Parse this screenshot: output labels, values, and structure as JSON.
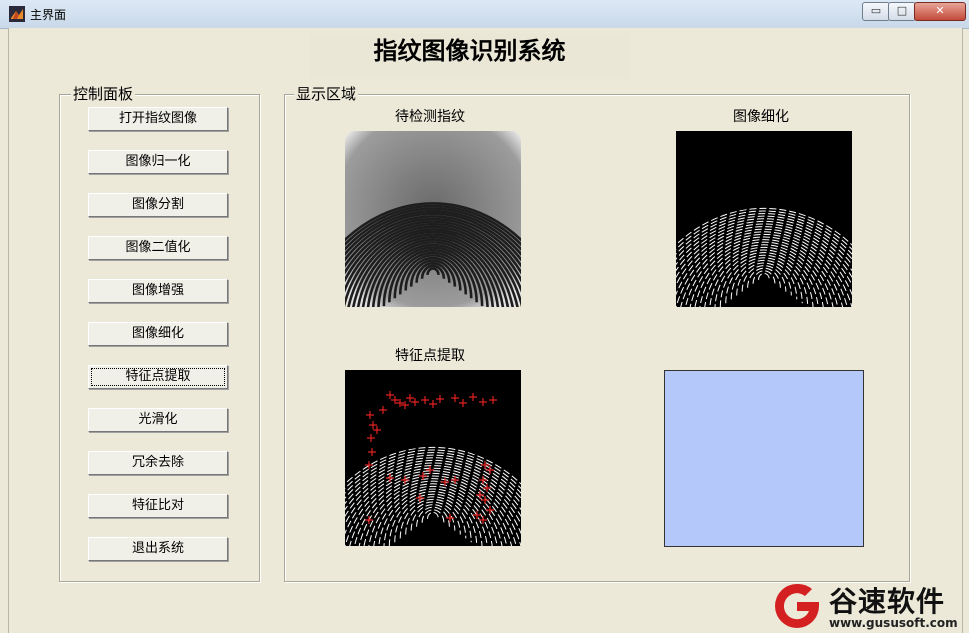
{
  "window": {
    "title": "主界面",
    "controls": {
      "minimize": "▭",
      "maximize": "□",
      "close": "✕"
    }
  },
  "heading": "指纹图像识别系统",
  "control_panel": {
    "label": "控制面板",
    "buttons": [
      "打开指纹图像",
      "图像归一化",
      "图像分割",
      "图像二值化",
      "图像增强",
      "图像细化",
      "特征点提取",
      "光滑化",
      "冗余去除",
      "特征比对",
      "退出系统"
    ]
  },
  "display_area": {
    "label": "显示区域",
    "axes": [
      {
        "title": "待检测指纹"
      },
      {
        "title": "图像细化"
      },
      {
        "title": "特征点提取"
      },
      {
        "title": ""
      }
    ]
  },
  "colors": {
    "empty_axis": "#b5c8fa",
    "minutiae_marker": "#e02020"
  },
  "watermark": {
    "name": "谷速软件",
    "url": "www.gususoft.com"
  }
}
